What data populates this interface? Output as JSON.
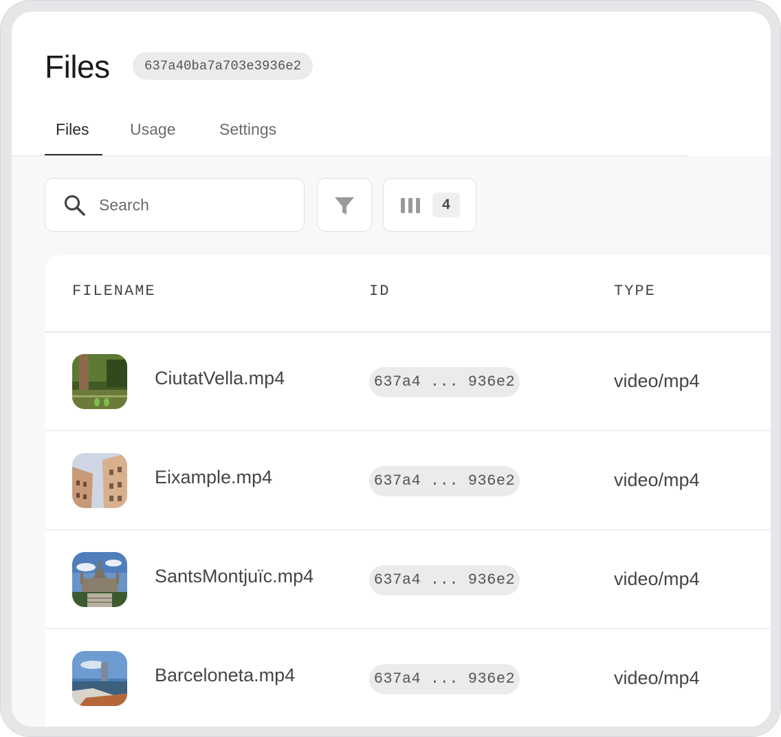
{
  "page": {
    "title": "Files",
    "project_id": "637a40ba7a703e3936e2"
  },
  "tabs": [
    {
      "label": "Files",
      "active": true
    },
    {
      "label": "Usage",
      "active": false
    },
    {
      "label": "Settings",
      "active": false
    }
  ],
  "toolbar": {
    "search_placeholder": "Search",
    "filter_icon": "funnel-icon",
    "columns_icon": "columns-icon",
    "column_count": "4"
  },
  "table": {
    "headers": [
      "FILENAME",
      "ID",
      "TYPE"
    ],
    "rows": [
      {
        "filename": "CiutatVella.mp4",
        "id": "637a4 ... 936e2",
        "type": "video/mp4",
        "thumb": "park-pond-with-parrots"
      },
      {
        "filename": "Eixample.mp4",
        "id": "637a4 ... 936e2",
        "type": "video/mp4",
        "thumb": "eixample-buildings"
      },
      {
        "filename": "SantsMontjuïc.mp4",
        "id": "637a4 ... 936e2",
        "type": "video/mp4",
        "thumb": "national-palace-montjuic"
      },
      {
        "filename": "Barceloneta.mp4",
        "id": "637a4 ... 936e2",
        "type": "video/mp4",
        "thumb": "barceloneta-beach"
      }
    ]
  },
  "colors": {
    "frame": "#e6e6e9",
    "content_bg": "#f8f8f8",
    "pill_bg": "#ebebeb",
    "text_primary": "#1a1a1a",
    "text_secondary": "#454545"
  }
}
